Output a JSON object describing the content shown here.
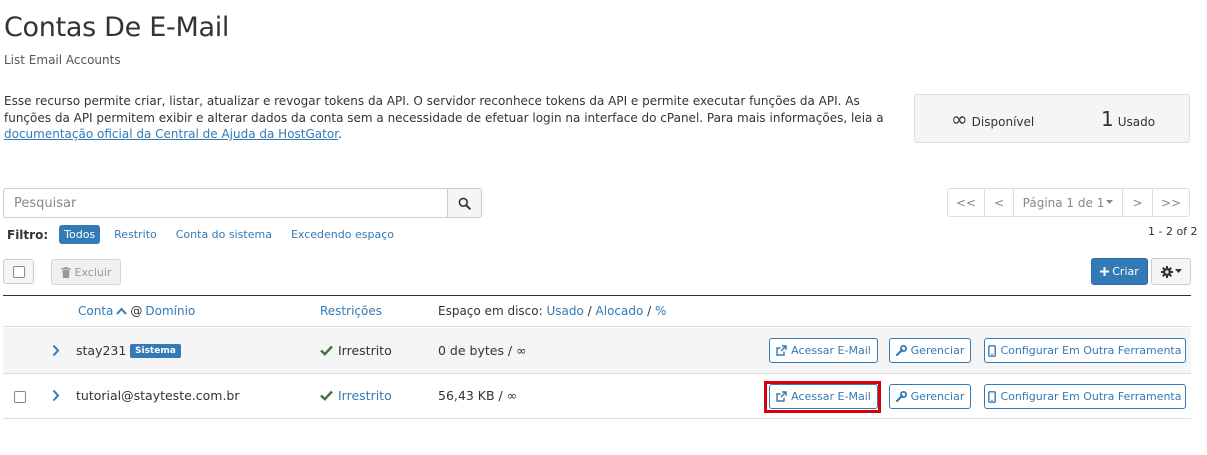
{
  "page": {
    "title": "Contas De E-Mail",
    "subtitle": "List Email Accounts",
    "description_prefix": "Esse recurso permite criar, listar, atualizar e revogar tokens da API. O servidor reconhece tokens da API e permite executar funções da API. As funções da API permitem exibir e alterar dados da conta sem a necessidade de efetuar login na interface do cPanel. Para mais informações, leia a ",
    "description_link": "documentação oficial da Central de Ajuda da HostGator",
    "description_suffix": "."
  },
  "stats": {
    "available_value": "∞",
    "available_label": "Disponível",
    "used_value": "1",
    "used_label": "Usado"
  },
  "search": {
    "placeholder": "Pesquisar",
    "icon": "search-icon"
  },
  "pagination": {
    "first": "<<",
    "prev": "<",
    "page_label": "Página 1 de 1",
    "next": ">",
    "last": ">>"
  },
  "filter": {
    "label": "Filtro:",
    "options": [
      "Todos",
      "Restrito",
      "Conta do sistema",
      "Excedendo espaço"
    ],
    "active": "Todos"
  },
  "results_count": "1 - 2 of 2",
  "toolbar": {
    "delete_label": "Excluir",
    "create_label": "Criar",
    "settings_icon": "gear-icon"
  },
  "table": {
    "headers": {
      "account": "Conta",
      "at": "@",
      "domain": "Domínio",
      "restrictions": "Restrições",
      "disk_prefix": "Espaço em disco:",
      "disk_used": "Usado",
      "sep1": "/",
      "disk_allocated": "Alocado",
      "sep2": "/",
      "disk_percent": "%"
    },
    "rows": [
      {
        "account": "stay231",
        "badge": "Sistema",
        "restriction": "Irrestrito",
        "disk": "0 de bytes / ∞",
        "access_label": "Acessar E-Mail",
        "manage_label": "Gerenciar",
        "configure_label": "Configurar Em Outra Ferramenta"
      },
      {
        "account": "tutorial@stayteste.com.br",
        "restriction": "Irrestrito",
        "disk": "56,43 KB / ∞",
        "access_label": "Acessar E-Mail",
        "manage_label": "Gerenciar",
        "configure_label": "Configurar Em Outra Ferramenta"
      }
    ]
  },
  "colors": {
    "accent": "#337ab7",
    "success": "#3c763d",
    "highlight": "#d9000d"
  }
}
